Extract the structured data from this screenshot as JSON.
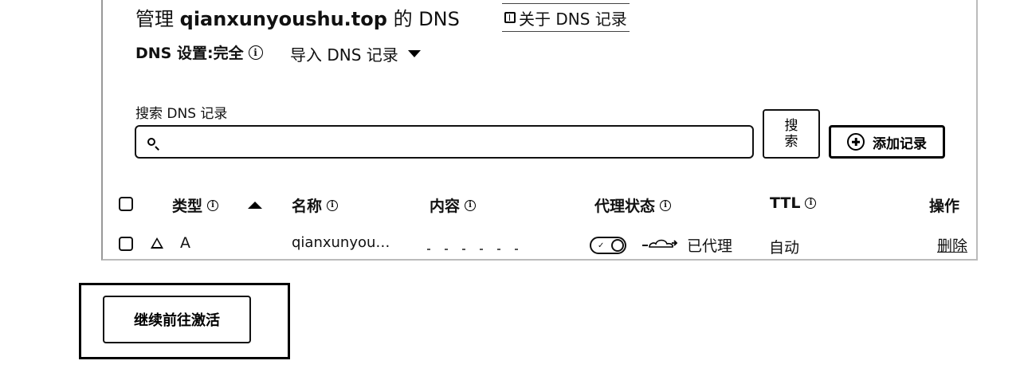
{
  "header": {
    "title_prefix": "管理",
    "domain": "qianxunyoushu.top",
    "title_suffix": "的 DNS",
    "about_link": "关于 DNS 记录"
  },
  "settings": {
    "dns_setting_label": "DNS 设置:完全",
    "import_label": "导入 DNS 记录"
  },
  "search": {
    "label": "搜索 DNS 记录",
    "placeholder": "",
    "button_label": "搜索",
    "add_record_label": "添加记录"
  },
  "table": {
    "columns": [
      "类型",
      "名称",
      "内容",
      "代理状态",
      "TTL",
      "操作"
    ],
    "rows": [
      {
        "type": "A",
        "name": "qianxunyou…",
        "content": "",
        "proxy_status": "已代理",
        "ttl": "自动",
        "action": "删除"
      }
    ]
  },
  "footer": {
    "continue_label": "继续前往激活"
  },
  "icons": [
    "book-icon",
    "info-icon",
    "chevron-down-icon",
    "search-icon",
    "plus-circle-icon",
    "sort-up-icon",
    "warning-icon",
    "toggle-switch",
    "cloud-icon"
  ]
}
